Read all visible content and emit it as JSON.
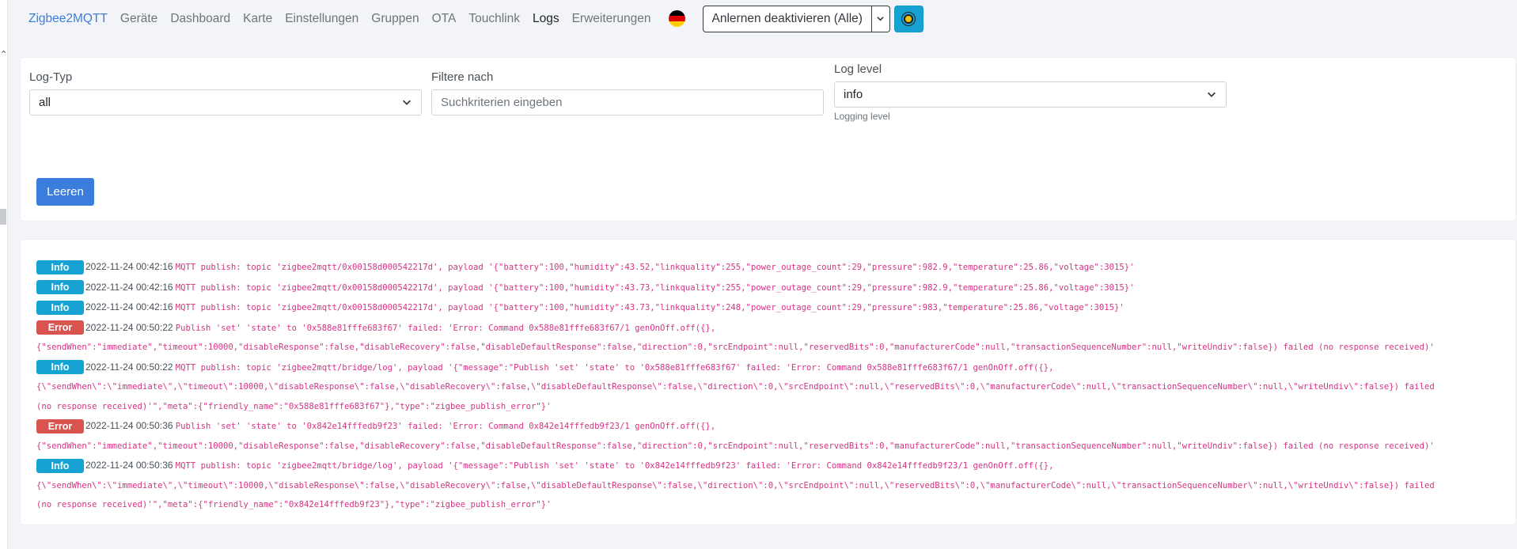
{
  "nav": {
    "brand": "Zigbee2MQTT",
    "links": [
      "Geräte",
      "Dashboard",
      "Karte",
      "Einstellungen",
      "Gruppen",
      "OTA",
      "Touchlink",
      "Logs",
      "Erweiterungen"
    ],
    "active": "Logs",
    "permit_join_label": "Anlernen deaktivieren (Alle)",
    "flag_colors": [
      "#000000",
      "#dd0000",
      "#ffce00"
    ],
    "theme_icon": "sun-icon"
  },
  "filters": {
    "log_type_label": "Log-Typ",
    "log_type_value": "all",
    "filter_label": "Filtere nach",
    "filter_placeholder": "Suchkriterien eingeben",
    "log_level_label": "Log level",
    "log_level_value": "info",
    "log_level_help": "Logging level",
    "clear_label": "Leeren"
  },
  "colors": {
    "accent": "#3b7ddd",
    "info_badge": "#17a2d4",
    "error_badge": "#d9534f",
    "message_text": "#d63384"
  },
  "logs": {
    "entries": [
      {
        "level": "Info",
        "time": "2022-11-24 00:42:16",
        "lines": [
          "MQTT publish: topic 'zigbee2mqtt/0x00158d000542217d', payload '{\"battery\":100,\"humidity\":43.52,\"linkquality\":255,\"power_outage_count\":29,\"pressure\":982.9,\"temperature\":25.86,\"voltage\":3015}'"
        ]
      },
      {
        "level": "Info",
        "time": "2022-11-24 00:42:16",
        "lines": [
          "MQTT publish: topic 'zigbee2mqtt/0x00158d000542217d', payload '{\"battery\":100,\"humidity\":43.73,\"linkquality\":255,\"power_outage_count\":29,\"pressure\":982.9,\"temperature\":25.86,\"voltage\":3015}'"
        ]
      },
      {
        "level": "Info",
        "time": "2022-11-24 00:42:16",
        "lines": [
          "MQTT publish: topic 'zigbee2mqtt/0x00158d000542217d', payload '{\"battery\":100,\"humidity\":43.73,\"linkquality\":248,\"power_outage_count\":29,\"pressure\":983,\"temperature\":25.86,\"voltage\":3015}'"
        ]
      },
      {
        "level": "Error",
        "time": "2022-11-24 00:50:22",
        "lines": [
          "Publish 'set' 'state' to '0x588e81fffe683f67' failed: 'Error: Command 0x588e81fffe683f67/1 genOnOff.off({},",
          "{\"sendWhen\":\"immediate\",\"timeout\":10000,\"disableResponse\":false,\"disableRecovery\":false,\"disableDefaultResponse\":false,\"direction\":0,\"srcEndpoint\":null,\"reservedBits\":0,\"manufacturerCode\":null,\"transactionSequenceNumber\":null,\"writeUndiv\":false}) failed (no response received)'"
        ]
      },
      {
        "level": "Info",
        "time": "2022-11-24 00:50:22",
        "lines": [
          "MQTT publish: topic 'zigbee2mqtt/bridge/log', payload '{\"message\":\"Publish 'set' 'state' to '0x588e81fffe683f67' failed: 'Error: Command 0x588e81fffe683f67/1 genOnOff.off({},",
          "{\\\"sendWhen\\\":\\\"immediate\\\",\\\"timeout\\\":10000,\\\"disableResponse\\\":false,\\\"disableRecovery\\\":false,\\\"disableDefaultResponse\\\":false,\\\"direction\\\":0,\\\"srcEndpoint\\\":null,\\\"reservedBits\\\":0,\\\"manufacturerCode\\\":null,\\\"transactionSequenceNumber\\\":null,\\\"writeUndiv\\\":false}) failed",
          "(no response received)'\",\"meta\":{\"friendly_name\":\"0x588e81fffe683f67\"},\"type\":\"zigbee_publish_error\"}'"
        ]
      },
      {
        "level": "Error",
        "time": "2022-11-24 00:50:36",
        "lines": [
          "Publish 'set' 'state' to '0x842e14fffedb9f23' failed: 'Error: Command 0x842e14fffedb9f23/1 genOnOff.off({},",
          "{\"sendWhen\":\"immediate\",\"timeout\":10000,\"disableResponse\":false,\"disableRecovery\":false,\"disableDefaultResponse\":false,\"direction\":0,\"srcEndpoint\":null,\"reservedBits\":0,\"manufacturerCode\":null,\"transactionSequenceNumber\":null,\"writeUndiv\":false}) failed (no response received)'"
        ]
      },
      {
        "level": "Info",
        "time": "2022-11-24 00:50:36",
        "lines": [
          "MQTT publish: topic 'zigbee2mqtt/bridge/log', payload '{\"message\":\"Publish 'set' 'state' to '0x842e14fffedb9f23' failed: 'Error: Command 0x842e14fffedb9f23/1 genOnOff.off({},",
          "{\\\"sendWhen\\\":\\\"immediate\\\",\\\"timeout\\\":10000,\\\"disableResponse\\\":false,\\\"disableRecovery\\\":false,\\\"disableDefaultResponse\\\":false,\\\"direction\\\":0,\\\"srcEndpoint\\\":null,\\\"reservedBits\\\":0,\\\"manufacturerCode\\\":null,\\\"transactionSequenceNumber\\\":null,\\\"writeUndiv\\\":false}) failed",
          "(no response received)'\",\"meta\":{\"friendly_name\":\"0x842e14fffedb9f23\"},\"type\":\"zigbee_publish_error\"}'"
        ]
      }
    ]
  }
}
